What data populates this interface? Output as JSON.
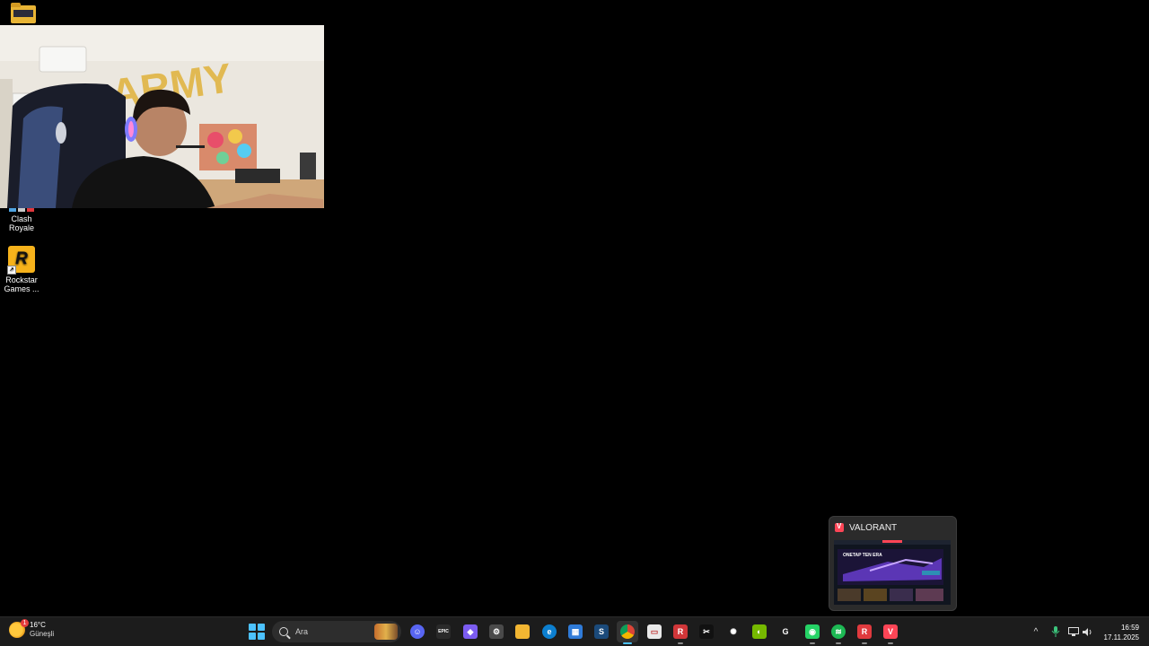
{
  "desktop": {
    "icons": [
      {
        "label": ""
      },
      {
        "label": "Clash Royale"
      },
      {
        "label": "Rockstar Games ..."
      }
    ],
    "rockstar_glyph": "R"
  },
  "preview": {
    "title": "VALORANT",
    "thumb_banner": "ONETAP TEN ERA"
  },
  "taskbar": {
    "weather": {
      "temperature": "16°C",
      "condition": "Güneşli",
      "badge": "1"
    },
    "search_placeholder": "Ara",
    "apps": [
      {
        "name": "discord",
        "glyph": "☺",
        "color": "#5865f2"
      },
      {
        "name": "epic-games",
        "glyph": "EPIC",
        "color": "#2a2a2a"
      },
      {
        "name": "copilot",
        "glyph": "◆",
        "color": "#7b5cf0"
      },
      {
        "name": "settings",
        "glyph": "⚙",
        "color": "#4a4a4a"
      },
      {
        "name": "file-explorer",
        "glyph": "",
        "color": "#f2b632"
      },
      {
        "name": "edge",
        "glyph": "e",
        "color": "#0c7fcf"
      },
      {
        "name": "microsoft-store",
        "glyph": "▦",
        "color": "#2f7bd8"
      },
      {
        "name": "steam",
        "glyph": "S",
        "color": "#1b4a7a"
      },
      {
        "name": "chrome",
        "glyph": "",
        "color": "#db4437"
      },
      {
        "name": "app-white",
        "glyph": "▭",
        "color": "#e9e9e9"
      },
      {
        "name": "riot-client",
        "glyph": "R",
        "color": "#d13639"
      },
      {
        "name": "capcut",
        "glyph": "✂",
        "color": "#111111"
      },
      {
        "name": "chatgpt",
        "glyph": "✺",
        "color": "#1c1c1c"
      },
      {
        "name": "nvidia",
        "glyph": "◐",
        "color": "#76b900"
      },
      {
        "name": "logitech-g",
        "glyph": "G",
        "color": "#1c1c1c"
      },
      {
        "name": "whatsapp-business",
        "glyph": "◉",
        "color": "#25d366"
      },
      {
        "name": "spotify",
        "glyph": "≋",
        "color": "#1db954"
      },
      {
        "name": "riot-games",
        "glyph": "R",
        "color": "#e03a3e"
      },
      {
        "name": "valorant",
        "glyph": "V",
        "color": "#fd4556"
      }
    ],
    "tray": {
      "chevron": "^",
      "time": "16:59",
      "date": "17.11.2025"
    }
  }
}
